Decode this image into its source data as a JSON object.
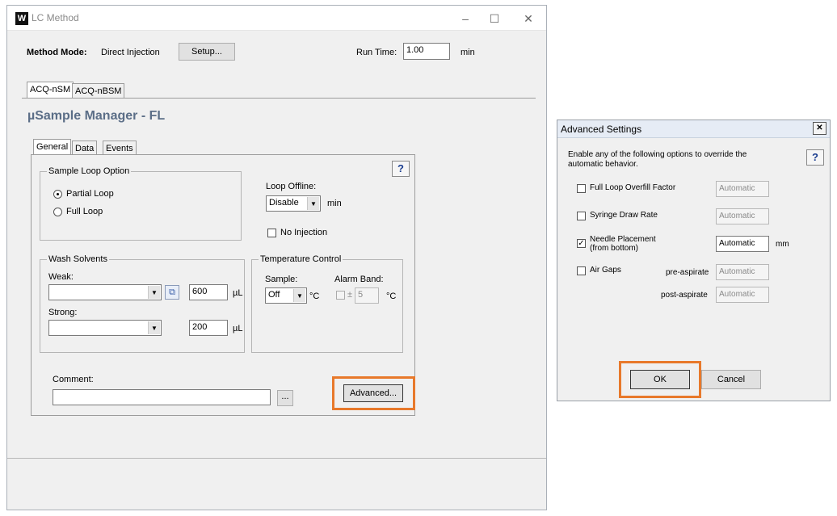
{
  "lc_window": {
    "title": "LC Method",
    "controls": {
      "minimize": "–",
      "maximize": "☐",
      "close": "✕"
    },
    "method_mode_label": "Method Mode:",
    "method_mode_value": "Direct Injection",
    "setup_button": "Setup...",
    "run_time_label": "Run Time:",
    "run_time_value": "1.00",
    "run_time_unit": "min",
    "outer_tabs": [
      "ACQ-nSM",
      "ACQ-nBSM"
    ],
    "module_title": "µSample Manager - FL",
    "inner_tabs": [
      "General",
      "Data",
      "Events"
    ],
    "help_label": "?",
    "sample_loop": {
      "title": "Sample Loop Option",
      "options": [
        "Partial Loop",
        "Full Loop"
      ],
      "selected": "Partial Loop"
    },
    "loop_offline": {
      "label": "Loop Offline:",
      "value": "Disable",
      "unit": "min",
      "no_injection_label": "No Injection"
    },
    "wash_solvents": {
      "title": "Wash Solvents",
      "weak_label": "Weak:",
      "weak_value": "",
      "weak_volume": "600",
      "strong_label": "Strong:",
      "strong_value": "",
      "strong_volume": "200",
      "unit": "µL"
    },
    "temperature_control": {
      "title": "Temperature Control",
      "sample_label": "Sample:",
      "sample_value": "Off",
      "sample_unit": "°C",
      "alarm_band_label": "Alarm Band:",
      "alarm_prefix": "±",
      "alarm_value": "5",
      "alarm_unit": "°C"
    },
    "comment_label": "Comment:",
    "comment_value": "",
    "ellipsis_button": "...",
    "advanced_button": "Advanced..."
  },
  "advanced_dialog": {
    "title": "Advanced Settings",
    "close": "✕",
    "description_line1": "Enable any of the following options to override the",
    "description_line2": "automatic behavior.",
    "help_label": "?",
    "full_loop_overfill": {
      "label": "Full Loop Overfill Factor",
      "checked": false,
      "value": "Automatic"
    },
    "syringe_draw_rate": {
      "label": "Syringe Draw Rate",
      "checked": false,
      "value": "Automatic"
    },
    "needle_placement": {
      "label_line1": "Needle Placement",
      "label_line2": "(from bottom)",
      "checked": true,
      "check_glyph": "✓",
      "value": "Automatic",
      "unit": "mm"
    },
    "air_gaps": {
      "label": "Air Gaps",
      "checked": false,
      "pre_label": "pre-aspirate",
      "pre_value": "Automatic",
      "post_label": "post-aspirate",
      "post_value": "Automatic"
    },
    "ok_button": "OK",
    "cancel_button": "Cancel"
  },
  "colors": {
    "highlight": "#e8792b",
    "module_title": "#5b6e87",
    "help_text": "#1a3d8f"
  }
}
